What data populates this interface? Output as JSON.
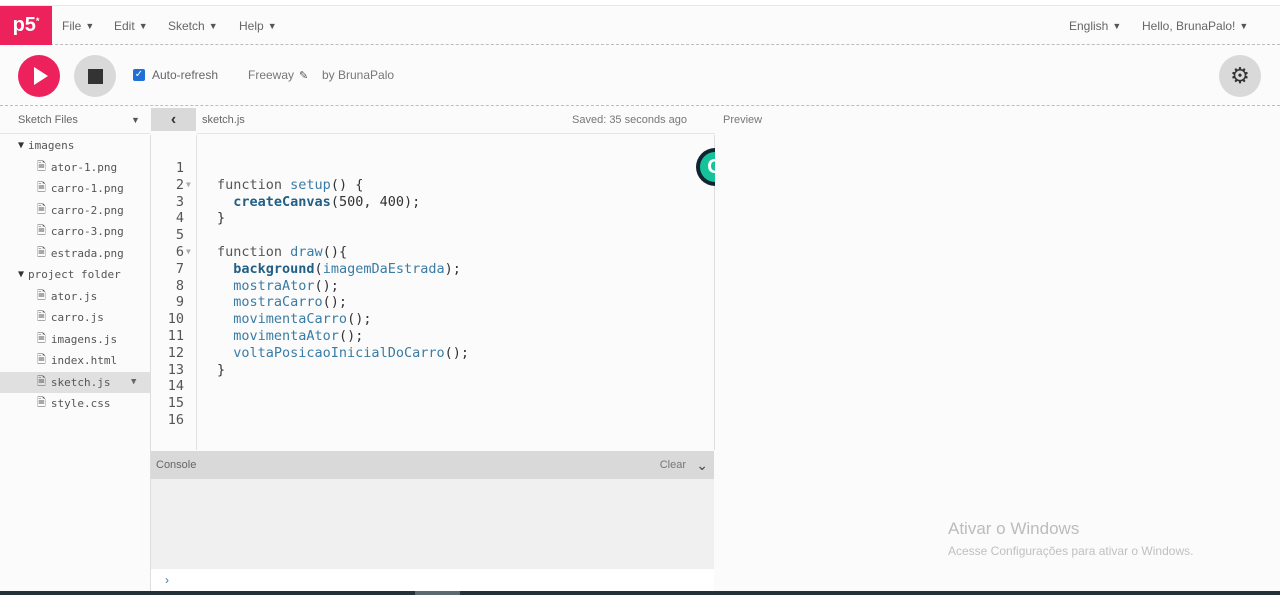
{
  "app": {
    "logo_text": "p5",
    "logo_mark": "*",
    "brand_color": "#ed225d"
  },
  "nav": {
    "menus": [
      {
        "label": "File"
      },
      {
        "label": "Edit"
      },
      {
        "label": "Sketch"
      },
      {
        "label": "Help"
      }
    ],
    "language": "English",
    "user_greeting": "Hello, BrunaPalo!"
  },
  "toolbar": {
    "play_icon": "play-icon",
    "stop_icon": "stop-icon",
    "auto_refresh_label": "Auto-refresh",
    "auto_refresh_checked": true,
    "project_name": "Freeway",
    "edit_icon": "pencil-icon",
    "byline": "by BrunaPalo",
    "settings_icon": "gear-icon"
  },
  "sidebar": {
    "title": "Sketch Files",
    "tree": [
      {
        "type": "folder",
        "name": "imagens"
      },
      {
        "type": "file",
        "name": "ator-1.png"
      },
      {
        "type": "file",
        "name": "carro-1.png"
      },
      {
        "type": "file",
        "name": "carro-2.png"
      },
      {
        "type": "file",
        "name": "carro-3.png"
      },
      {
        "type": "file",
        "name": "estrada.png"
      },
      {
        "type": "folder",
        "name": "project folder"
      },
      {
        "type": "file",
        "name": "ator.js"
      },
      {
        "type": "file",
        "name": "carro.js"
      },
      {
        "type": "file",
        "name": "imagens.js"
      },
      {
        "type": "file",
        "name": "index.html"
      },
      {
        "type": "file",
        "name": "sketch.js",
        "selected": true
      },
      {
        "type": "file",
        "name": "style.css"
      }
    ]
  },
  "editor": {
    "filename": "sketch.js",
    "saved_status": "Saved: 35 seconds ago",
    "lines": [
      {
        "n": "1",
        "text": ""
      },
      {
        "n": "2",
        "text": "function setup() {",
        "fold": true
      },
      {
        "n": "3",
        "text": "  createCanvas(500, 400);"
      },
      {
        "n": "4",
        "text": "}"
      },
      {
        "n": "5",
        "text": ""
      },
      {
        "n": "6",
        "text": "function draw(){",
        "fold": true
      },
      {
        "n": "7",
        "text": "  background(imagemDaEstrada);"
      },
      {
        "n": "8",
        "text": "  mostraAtor();"
      },
      {
        "n": "9",
        "text": "  mostraCarro();"
      },
      {
        "n": "10",
        "text": "  movimentaCarro();"
      },
      {
        "n": "11",
        "text": "  movimentaAtor();"
      },
      {
        "n": "12",
        "text": "  voltaPosicaoInicialDoCarro();"
      },
      {
        "n": "13",
        "text": "}"
      },
      {
        "n": "14",
        "text": ""
      },
      {
        "n": "15",
        "text": ""
      },
      {
        "n": "16",
        "text": ""
      }
    ]
  },
  "preview": {
    "label": "Preview"
  },
  "console": {
    "title": "Console",
    "clear_label": "Clear",
    "prompt": "›"
  },
  "overlay": {
    "grammarly_letter": "G",
    "watermark_title": "Ativar o Windows",
    "watermark_subtitle": "Acesse Configurações para ativar o Windows."
  }
}
